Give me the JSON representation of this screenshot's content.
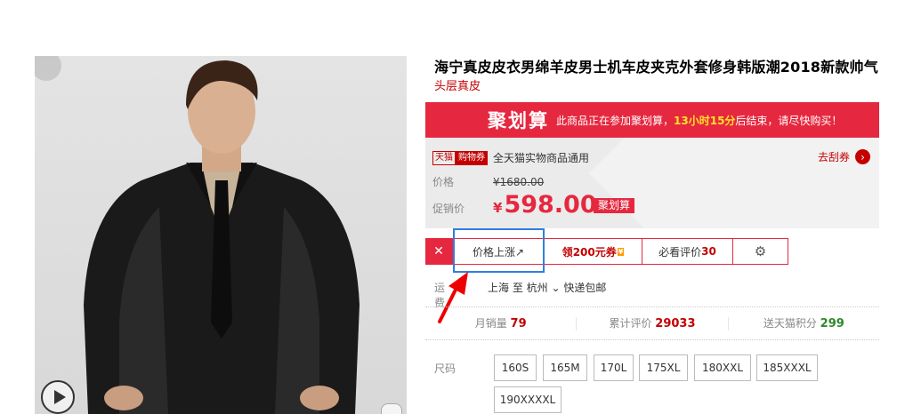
{
  "product": {
    "title": "海宁真皮皮衣男绵羊皮男士机车皮夹克外套修身韩版潮2018新款帅气",
    "subtitle": "头层真皮"
  },
  "jhs": {
    "logo": "聚划算",
    "msg_prefix": "此商品正在参加聚划算，",
    "time_text": "13小时15分",
    "msg_suffix": "后结束，请尽快购买！"
  },
  "promo": {
    "tag_tmall": "天猫",
    "tag_shop": "购物券",
    "coupon_text": "全天猫实物商品通用",
    "get_coupon": "去刮券",
    "price_label": "价格",
    "original_price": "¥1680.00",
    "promo_label": "促销价",
    "yen": "¥",
    "promo_price": "598.00",
    "jhs_tag": "聚划算"
  },
  "toolbar": {
    "close_glyph": "✕",
    "price_up": "价格上涨↗",
    "coupon_prefix": "领",
    "coupon_amount": "200元券",
    "coupon_badge": "¥",
    "review_prefix": "必看评价",
    "review_count": "30",
    "gear_glyph": "⚙"
  },
  "shipping": {
    "label": "运费",
    "from": "上海  至  杭州 ⌄  快递包邮"
  },
  "stats": {
    "monthly_label": "月销量",
    "monthly_value": "79",
    "reviews_label": "累计评价",
    "reviews_value": "29033",
    "points_label": "送天猫积分",
    "points_value": "299"
  },
  "size": {
    "label": "尺码",
    "options": [
      "160S",
      "165M",
      "170L",
      "175XL",
      "180XXL",
      "185XXXL",
      "190XXXXL"
    ]
  },
  "icons": {
    "play": "play-icon",
    "gear": "gear-icon",
    "arrow": "arrow-right-icon",
    "close": "close-icon"
  },
  "colors": {
    "accent": "#e5283f",
    "brand_red": "#c40000",
    "highlight": "#2f7fe0"
  }
}
